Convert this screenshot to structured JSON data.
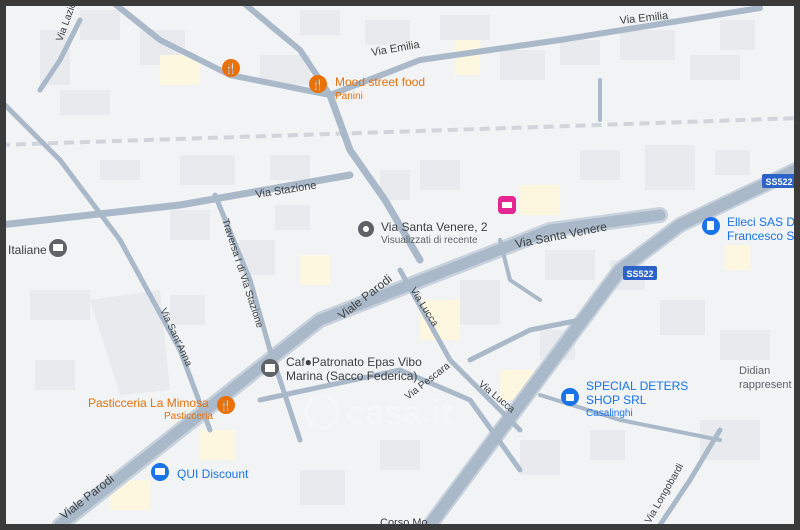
{
  "map": {
    "colors": {
      "background": "#f1f3f4",
      "building": "#e8eaed",
      "building_highlight": "#fef7e0",
      "road": "#aab9c9",
      "road_edge": "#c7d2dd",
      "rail": "#cfd5db",
      "road_label": "#3c4043",
      "poi_food": "#e8710a",
      "poi_shop": "#1a73e8",
      "poi_hotel": "#e52592",
      "poi_service": "#5f6368",
      "shield_bg": "#2b63c8"
    },
    "streets": {
      "via_emilia_1": "Via Emilia",
      "via_emilia_2": "Via Emilia",
      "via_stazione": "Via Stazione",
      "via_santa_venere": "Via Santa Venere",
      "viale_parodi_1": "Viale Parodi",
      "viale_parodi_2": "Viale Parodi",
      "traversa_stazione": "Traversa I di Via Stazione",
      "via_santanna": "Via Sant'Anna",
      "via_lucca_1": "Via Lucca",
      "via_lucca_2": "Via Lucca",
      "via_pescara": "Via Pescara",
      "via_lazio": "Via Lazio",
      "via_longobardi": "Via Longobardi"
    },
    "shields": {
      "ss522_top": "SS522",
      "ss522_mid": "SS522"
    },
    "pois": {
      "mood": {
        "name": "Mood street food",
        "sub": "Panini",
        "icon": "fork-knife-icon"
      },
      "santa_venere": {
        "name": "Via Santa Venere, 2",
        "sub": "Visualizzati di recente",
        "icon": "pin-icon"
      },
      "hotel": {
        "icon": "bed-icon"
      },
      "elleci": {
        "name_1": "Elleci SAS D",
        "name_2": "Francesco S",
        "icon": "fuel-icon"
      },
      "poste": {
        "name": "Italiane",
        "icon": "mail-icon"
      },
      "patronato": {
        "name_1": "Caf●Patronato Epas Vibo",
        "name_2": "Marina (Sacco Federica)",
        "icon": "building-icon"
      },
      "pasticceria": {
        "name": "Pasticceria La Mimosa",
        "sub": "Pasticceria",
        "icon": "fork-knife-icon"
      },
      "qui": {
        "name": "QUI Discount",
        "icon": "cart-icon"
      },
      "special": {
        "name_1": "SPECIAL DETERS",
        "name_2": "SHOP SRL",
        "sub": "Casalinghi",
        "icon": "shopping-bag-icon"
      },
      "didian": {
        "name_1": "Didian",
        "name_2": "rappresent"
      }
    },
    "watermark": "casa.it",
    "bottom_partial": "Corso Mo"
  }
}
